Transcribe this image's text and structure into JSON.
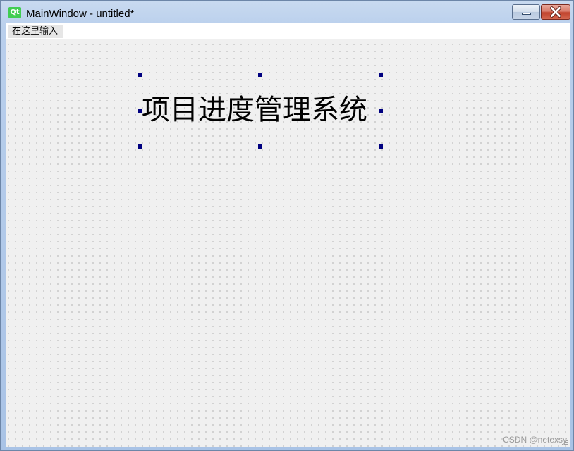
{
  "window": {
    "title": "MainWindow - untitled*",
    "app_icon_text": "Qt",
    "app_icon_color": "#41cd52"
  },
  "menubar": {
    "placeholder_entry": "在这里输入"
  },
  "form": {
    "label_text": "项目进度管理系统",
    "selection_handle_color": "#000080"
  },
  "watermark": "CSDN @netexsy"
}
